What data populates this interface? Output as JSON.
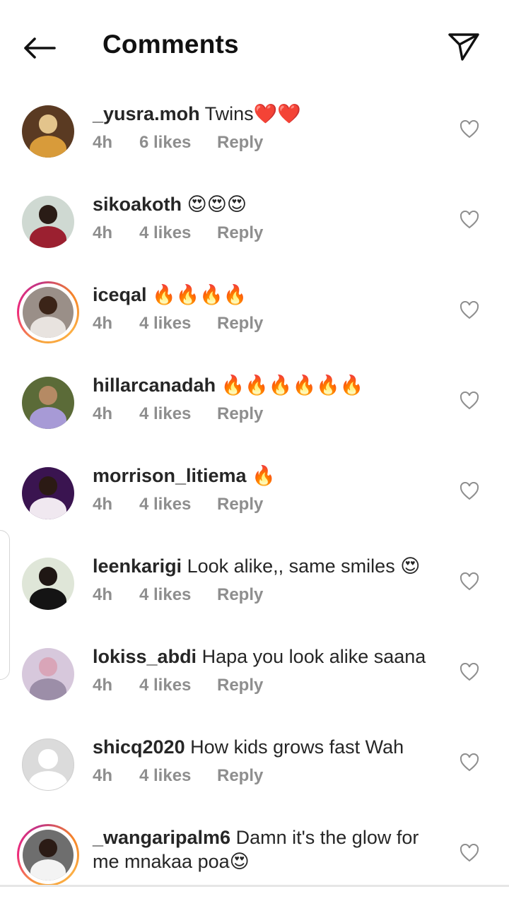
{
  "header": {
    "title": "Comments",
    "back_icon": "arrow-left-icon",
    "share_icon": "paper-plane-icon"
  },
  "comments": [
    {
      "username": "_yusra.moh",
      "text": "Twins❤️❤️",
      "time": "4h",
      "likes": "6 likes",
      "reply": "Reply"
    },
    {
      "username": "sikoakoth",
      "text": "😍😍😍",
      "time": "4h",
      "likes": "4 likes",
      "reply": "Reply"
    },
    {
      "username": "iceqal",
      "text": "🔥🔥🔥🔥",
      "time": "4h",
      "likes": "4 likes",
      "reply": "Reply"
    },
    {
      "username": "hillarcanadah",
      "text": "🔥🔥🔥🔥🔥🔥",
      "time": "4h",
      "likes": "4 likes",
      "reply": "Reply"
    },
    {
      "username": "morrison_litiema",
      "text": "🔥",
      "time": "4h",
      "likes": "4 likes",
      "reply": "Reply"
    },
    {
      "username": "leenkarigi",
      "text": "Look alike,, same smiles 😍",
      "time": "4h",
      "likes": "4 likes",
      "reply": "Reply"
    },
    {
      "username": "lokiss_abdi",
      "text": "Hapa you look alike saana",
      "time": "4h",
      "likes": "4 likes",
      "reply": "Reply"
    },
    {
      "username": "shicq2020",
      "text": "How kids grows fast Wah",
      "time": "4h",
      "likes": "4 likes",
      "reply": "Reply"
    },
    {
      "username": "_wangaripalm6",
      "text": "Damn it's the glow for me mnakaa poa😍",
      "time": "",
      "likes": "",
      "reply": ""
    }
  ],
  "icons": {
    "like": "heart-outline-icon"
  },
  "colors": {
    "meta_text": "#8e8e8e",
    "story_ring": "#ee2a7b"
  }
}
